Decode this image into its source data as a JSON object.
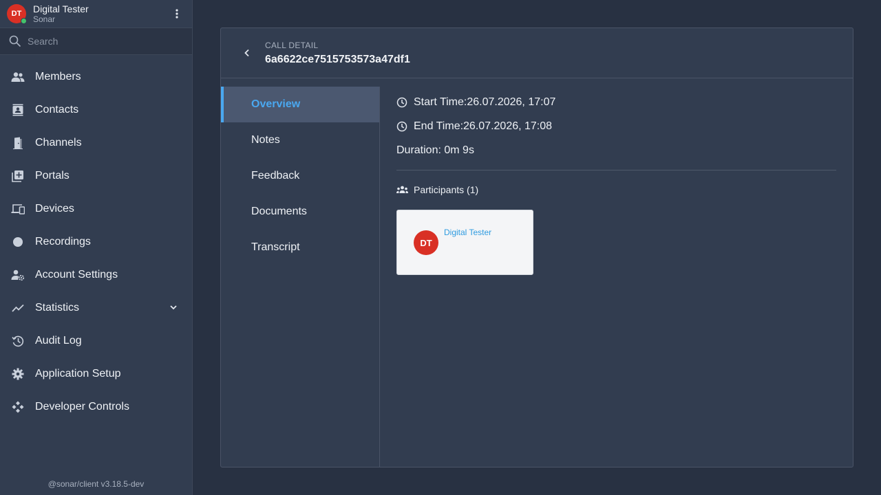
{
  "user": {
    "initials": "DT",
    "name": "Digital Tester",
    "org": "Sonar",
    "status_color": "#44c26b",
    "avatar_color": "#d93025"
  },
  "search": {
    "placeholder": "Search",
    "value": ""
  },
  "sidebar": {
    "items": [
      {
        "label": "Members",
        "icon": "members-icon"
      },
      {
        "label": "Contacts",
        "icon": "contacts-icon"
      },
      {
        "label": "Channels",
        "icon": "channels-icon"
      },
      {
        "label": "Portals",
        "icon": "portals-icon"
      },
      {
        "label": "Devices",
        "icon": "devices-icon"
      },
      {
        "label": "Recordings",
        "icon": "recordings-icon"
      },
      {
        "label": "Account Settings",
        "icon": "account-settings-icon"
      },
      {
        "label": "Statistics",
        "icon": "statistics-icon",
        "expandable": true
      },
      {
        "label": "Audit Log",
        "icon": "audit-log-icon"
      },
      {
        "label": "Application Setup",
        "icon": "gear-icon"
      },
      {
        "label": "Developer Controls",
        "icon": "developer-controls-icon"
      }
    ],
    "version": "@sonar/client v3.18.5-dev"
  },
  "call": {
    "kicker": "CALL DETAIL",
    "id": "6a6622ce7515753573a47df1"
  },
  "tabs": [
    {
      "label": "Overview",
      "active": true
    },
    {
      "label": "Notes",
      "active": false
    },
    {
      "label": "Feedback",
      "active": false
    },
    {
      "label": "Documents",
      "active": false
    },
    {
      "label": "Transcript",
      "active": false
    }
  ],
  "overview": {
    "start_time": "Start Time:26.07.2026, 17:07",
    "end_time": "End Time:26.07.2026, 17:08",
    "duration": "Duration: 0m 9s",
    "participants_label": "Participants (1)",
    "participants": [
      {
        "initials": "DT",
        "name": "Digital Tester"
      }
    ]
  },
  "colors": {
    "accent": "#4aa8f0",
    "link": "#2e9be0",
    "background": "#283142",
    "panel": "#323d50"
  }
}
